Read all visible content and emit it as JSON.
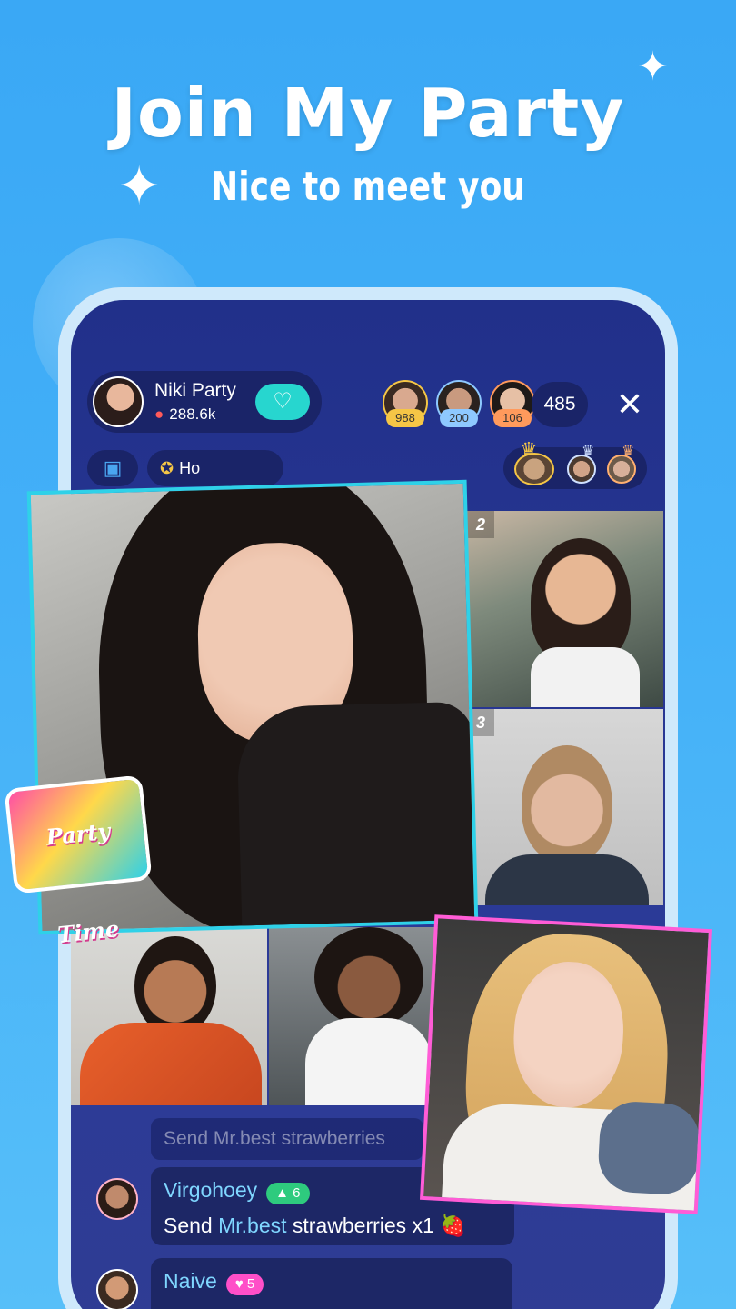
{
  "promo": {
    "headline": "Join My Party",
    "subline": "Nice to meet you"
  },
  "room": {
    "host_name": "Niki Party",
    "host_stat": "288.6k",
    "top_contributors": [
      {
        "badge": "988",
        "badge_color": "#f5c646"
      },
      {
        "badge": "200",
        "badge_color": "#8ec9ff"
      },
      {
        "badge": "106",
        "badge_color": "#ff9a5c"
      }
    ],
    "viewer_count": "485",
    "close_label": "✕",
    "hour_label": "Ho"
  },
  "seats": [
    {
      "num": "2"
    },
    {
      "num": "3"
    }
  ],
  "chat": {
    "faded": "Send Mr.best strawberries",
    "messages": [
      {
        "name": "Virgohoey",
        "level": "▲ 6",
        "level_color": "#2ecb7e",
        "prefix": "Send ",
        "target": "Mr.best",
        "suffix": " strawberries x1 🍓"
      },
      {
        "name": "Naive",
        "level": "♥ 5",
        "level_color": "#ff4fc8",
        "prefix": "",
        "target": "",
        "suffix": ""
      }
    ]
  },
  "sticker": {
    "label": "Party Time"
  },
  "colors": {
    "accent": "#27d6cf",
    "highlight_frame_blue": "#2fd1e8",
    "highlight_frame_pink": "#ff5cd6"
  }
}
